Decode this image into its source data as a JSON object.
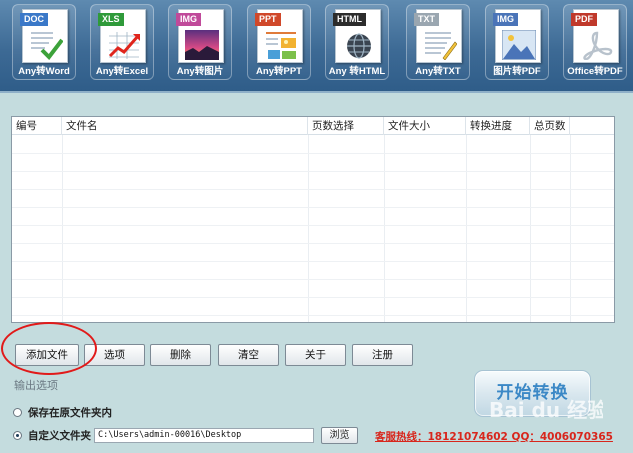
{
  "toolbar": {
    "tools": [
      {
        "tag": "DOC",
        "caption": "Any转Word",
        "icon": "word-doc-icon",
        "tag_color": "#3a78c8"
      },
      {
        "tag": "XLS",
        "caption": "Any转Excel",
        "icon": "excel-chart-icon",
        "tag_color": "#2f9a3a"
      },
      {
        "tag": "IMG",
        "caption": "Any转图片",
        "icon": "image-icon",
        "tag_color": "#c04a9a"
      },
      {
        "tag": "PPT",
        "caption": "Any转PPT",
        "icon": "ppt-icon",
        "tag_color": "#d0482a"
      },
      {
        "tag": "HTML",
        "caption": "Any 转HTML",
        "icon": "globe-icon",
        "tag_color": "#2c2c2c"
      },
      {
        "tag": "TXT",
        "caption": "Any转TXT",
        "icon": "text-doc-icon",
        "tag_color": "#9aa6b0"
      },
      {
        "tag": "IMG",
        "caption": "图片转PDF",
        "icon": "picture-icon",
        "tag_color": "#4a74b8"
      },
      {
        "tag": "PDF",
        "caption": "Office转PDF",
        "icon": "pdf-icon",
        "tag_color": "#c0392b"
      }
    ]
  },
  "file_table": {
    "columns": [
      "编号",
      "文件名",
      "页数选择",
      "文件大小",
      "转换进度",
      "总页数"
    ],
    "rows": []
  },
  "buttons": {
    "add_file": "添加文件",
    "options": "选项",
    "delete": "删除",
    "clear": "清空",
    "about": "关于",
    "register": "注册",
    "browse": "浏览",
    "start": "开始转换"
  },
  "output": {
    "section_label": "输出选项",
    "keep_original_label": "保存在原文件夹内",
    "custom_folder_label": "自定义文件夹",
    "selected": "custom",
    "path": "C:\\Users\\admin-00016\\Desktop"
  },
  "hotline": "客服热线：18121074602 QQ：4006070365",
  "watermark": "Bai du 经验",
  "colors": {
    "toolbar": "#3d6a95",
    "background": "#c4dcde",
    "highlight": "#e11a1a",
    "hotline": "#d8261c",
    "start_text": "#3b88c6"
  }
}
